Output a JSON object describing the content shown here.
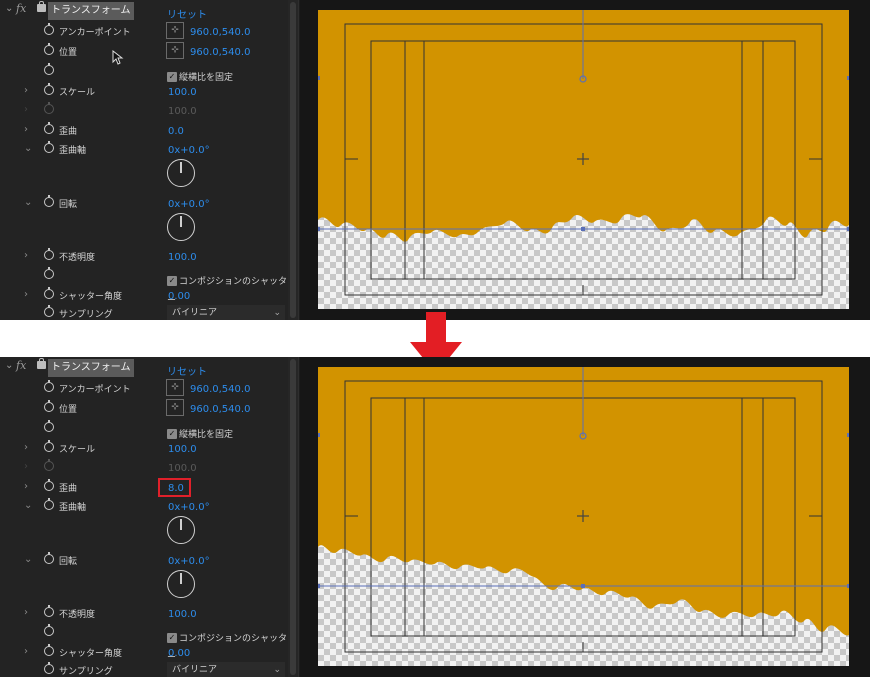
{
  "fx": {
    "label": "fx",
    "name": "トランスフォーム",
    "reset": "リセット"
  },
  "before": {
    "anchor_label": "アンカーポイント",
    "anchor_value": "960.0,540.0",
    "position_label": "位置",
    "position_value": "960.0,540.0",
    "uniform_label": "縦横比を固定",
    "scale_label": "スケール",
    "scale_value": "100.0",
    "scale_h_value": "100.0",
    "skew_label": "歪曲",
    "skew_value": "0.0",
    "skew_axis_label": "歪曲軸",
    "skew_axis_value": "0x+0.0°",
    "rotation_label": "回転",
    "rotation_value": "0x+0.0°",
    "opacity_label": "不透明度",
    "opacity_value": "100.0",
    "comp_shutter_label": "コンポジションのシャッター",
    "shutter_label": "シャッター角度",
    "shutter_value": "0.00",
    "sampling_label": "サンプリング",
    "sampling_value": "バイリニア"
  },
  "after": {
    "anchor_label": "アンカーポイント",
    "anchor_value": "960.0,540.0",
    "position_label": "位置",
    "position_value": "960.0,540.0",
    "uniform_label": "縦横比を固定",
    "scale_label": "スケール",
    "scale_value": "100.0",
    "scale_h_value": "100.0",
    "skew_label": "歪曲",
    "skew_value": "8.0",
    "skew_axis_label": "歪曲軸",
    "skew_axis_value": "0x+0.0°",
    "rotation_label": "回転",
    "rotation_value": "0x+0.0°",
    "opacity_label": "不透明度",
    "opacity_value": "100.0",
    "comp_shutter_label": "コンポジションのシャッター",
    "shutter_label": "シャッター角度",
    "shutter_value": "0.00",
    "sampling_label": "サンプリング",
    "sampling_value": "バイリニア"
  },
  "colors": {
    "fill": "#d29300",
    "accent": "#2d8ceb",
    "highlight": "#e0202a",
    "arrow": "#e31e24"
  },
  "icons": {
    "arrow": "down-arrow-icon",
    "anchor": "anchor-target-icon",
    "stopwatch": "stopwatch-icon",
    "cursor": "mouse-cursor-icon"
  }
}
